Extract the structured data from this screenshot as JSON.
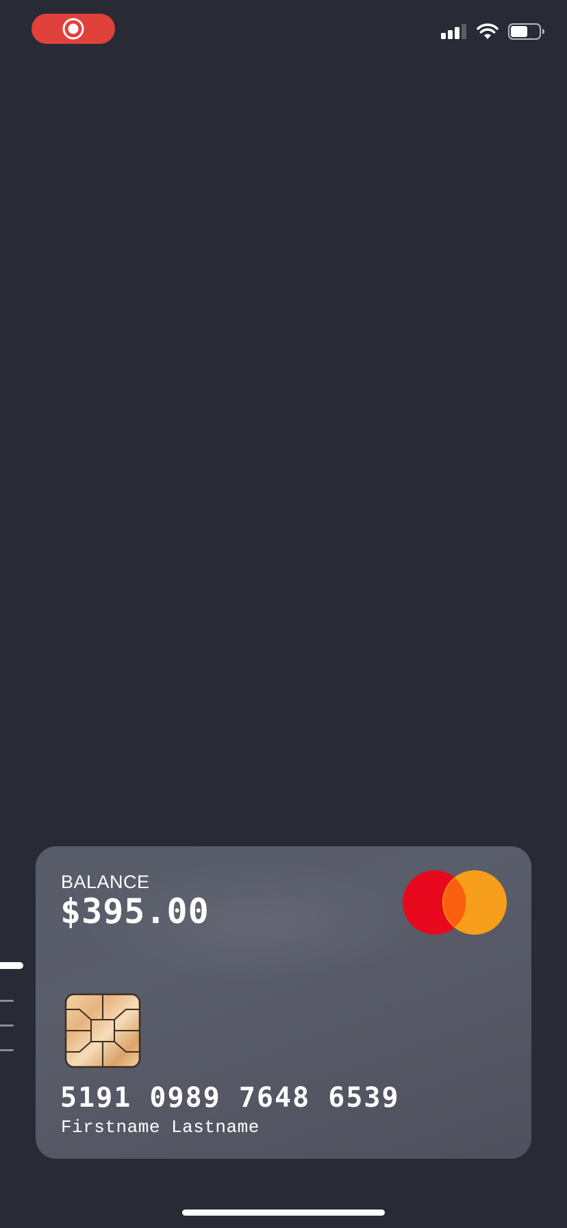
{
  "status_bar": {
    "record_icon": "screen-record-icon",
    "signal_icon": "cellular-signal-icon",
    "wifi_icon": "wifi-icon",
    "battery_icon": "battery-icon",
    "battery_level": 0.6,
    "record_color": "#e0413b"
  },
  "card": {
    "balance_label": "BALANCE",
    "balance_amount": "$395.00",
    "brand_icon": "mastercard-logo-icon",
    "chip_icon": "emv-chip-icon",
    "card_number": "5191 0989 7648 6539",
    "cardholder_name": "Firstname Lastname",
    "colors": {
      "background": "#585b68",
      "brand_red": "#e8091f",
      "brand_orange": "#f79e1b",
      "brand_overlap": "#fa5f0f"
    }
  },
  "page_indicator": {
    "count": 4,
    "active_index": 0
  },
  "colors": {
    "page_background": "#282a36",
    "text": "#ffffff"
  }
}
